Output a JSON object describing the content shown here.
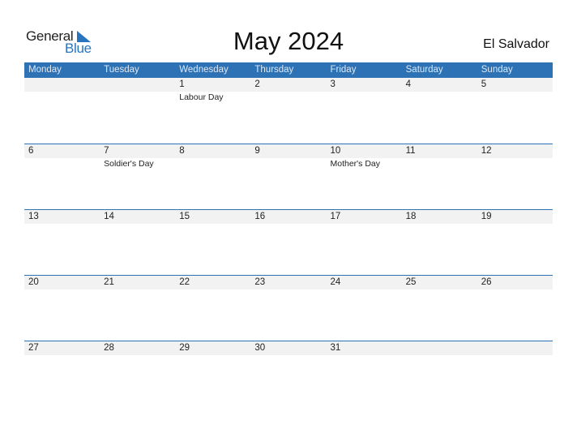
{
  "logo": {
    "word1": "General",
    "word2": "Blue",
    "accent_color": "#2a74be"
  },
  "title": "May 2024",
  "country": "El Salvador",
  "header_color": "#2d72b5",
  "weekdays": [
    "Monday",
    "Tuesday",
    "Wednesday",
    "Thursday",
    "Friday",
    "Saturday",
    "Sunday"
  ],
  "weeks": [
    {
      "days": [
        {
          "day": "",
          "holiday": ""
        },
        {
          "day": "",
          "holiday": ""
        },
        {
          "day": "1",
          "holiday": "Labour Day"
        },
        {
          "day": "2",
          "holiday": ""
        },
        {
          "day": "3",
          "holiday": ""
        },
        {
          "day": "4",
          "holiday": ""
        },
        {
          "day": "5",
          "holiday": ""
        }
      ]
    },
    {
      "days": [
        {
          "day": "6",
          "holiday": ""
        },
        {
          "day": "7",
          "holiday": "Soldier's Day"
        },
        {
          "day": "8",
          "holiday": ""
        },
        {
          "day": "9",
          "holiday": ""
        },
        {
          "day": "10",
          "holiday": "Mother's Day"
        },
        {
          "day": "11",
          "holiday": ""
        },
        {
          "day": "12",
          "holiday": ""
        }
      ]
    },
    {
      "days": [
        {
          "day": "13",
          "holiday": ""
        },
        {
          "day": "14",
          "holiday": ""
        },
        {
          "day": "15",
          "holiday": ""
        },
        {
          "day": "16",
          "holiday": ""
        },
        {
          "day": "17",
          "holiday": ""
        },
        {
          "day": "18",
          "holiday": ""
        },
        {
          "day": "19",
          "holiday": ""
        }
      ]
    },
    {
      "days": [
        {
          "day": "20",
          "holiday": ""
        },
        {
          "day": "21",
          "holiday": ""
        },
        {
          "day": "22",
          "holiday": ""
        },
        {
          "day": "23",
          "holiday": ""
        },
        {
          "day": "24",
          "holiday": ""
        },
        {
          "day": "25",
          "holiday": ""
        },
        {
          "day": "26",
          "holiday": ""
        }
      ]
    },
    {
      "days": [
        {
          "day": "27",
          "holiday": ""
        },
        {
          "day": "28",
          "holiday": ""
        },
        {
          "day": "29",
          "holiday": ""
        },
        {
          "day": "30",
          "holiday": ""
        },
        {
          "day": "31",
          "holiday": ""
        },
        {
          "day": "",
          "holiday": ""
        },
        {
          "day": "",
          "holiday": ""
        }
      ]
    }
  ]
}
